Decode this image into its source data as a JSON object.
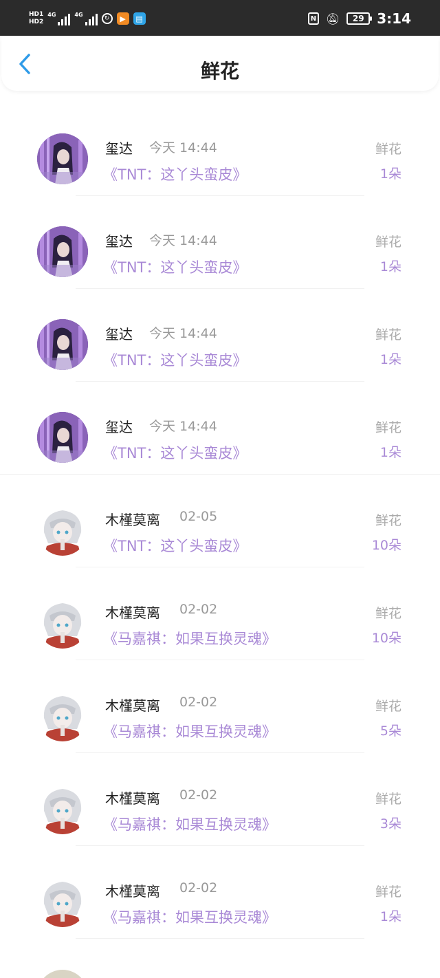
{
  "status_bar": {
    "hd1": "HD",
    "hd1_sub": "1",
    "hd2": "HD",
    "hd2_sub": "2",
    "sig1_label": "4G",
    "sig2_label": "4G",
    "battery": "29",
    "time": "3:14",
    "icons": [
      "network-speed-icon",
      "video-app-icon",
      "book-app-icon",
      "nfc-icon",
      "bell-muted-icon"
    ]
  },
  "header": {
    "title": "鲜花",
    "back_icon": "chevron-left-icon",
    "accent_color": "#2f9be8"
  },
  "colors": {
    "work_title": "#a989d6",
    "meta": "#999999"
  },
  "rows": [
    {
      "name": "玺达",
      "time": "今天 14:44",
      "work": "《TNT：这丫头蛮皮》",
      "kind": "鲜花",
      "count": "1朵",
      "avatar": "purple-portrait-avatar"
    },
    {
      "name": "玺达",
      "time": "今天 14:44",
      "work": "《TNT：这丫头蛮皮》",
      "kind": "鲜花",
      "count": "1朵",
      "avatar": "purple-portrait-avatar"
    },
    {
      "name": "玺达",
      "time": "今天 14:44",
      "work": "《TNT：这丫头蛮皮》",
      "kind": "鲜花",
      "count": "1朵",
      "avatar": "purple-portrait-avatar"
    },
    {
      "name": "玺达",
      "time": "今天 14:44",
      "work": "《TNT：这丫头蛮皮》",
      "kind": "鲜花",
      "count": "1朵",
      "avatar": "purple-portrait-avatar"
    },
    {
      "name": "木槿莫离",
      "time": "02-05",
      "work": "《TNT：这丫头蛮皮》",
      "kind": "鲜花",
      "count": "10朵",
      "avatar": "silver-hair-anime-avatar"
    },
    {
      "name": "木槿莫离",
      "time": "02-02",
      "work": "《马嘉祺：如果互换灵魂》",
      "kind": "鲜花",
      "count": "10朵",
      "avatar": "silver-hair-anime-avatar"
    },
    {
      "name": "木槿莫离",
      "time": "02-02",
      "work": "《马嘉祺：如果互换灵魂》",
      "kind": "鲜花",
      "count": "5朵",
      "avatar": "silver-hair-anime-avatar"
    },
    {
      "name": "木槿莫离",
      "time": "02-02",
      "work": "《马嘉祺：如果互换灵魂》",
      "kind": "鲜花",
      "count": "3朵",
      "avatar": "silver-hair-anime-avatar"
    },
    {
      "name": "木槿莫离",
      "time": "02-02",
      "work": "《马嘉祺：如果互换灵魂》",
      "kind": "鲜花",
      "count": "1朵",
      "avatar": "silver-hair-anime-avatar"
    }
  ]
}
